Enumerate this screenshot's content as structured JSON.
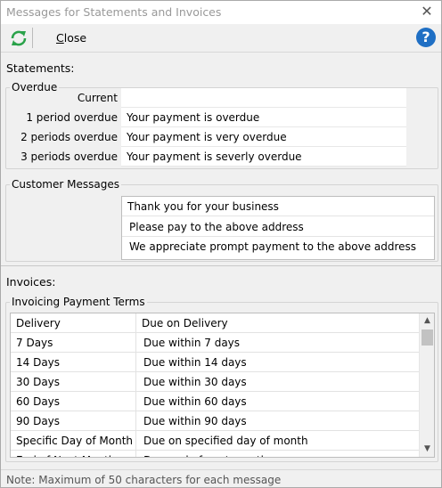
{
  "window": {
    "title": "Messages for Statements and Invoices"
  },
  "toolbar": {
    "close_label": "Close",
    "help_label": "?"
  },
  "statements": {
    "label": "Statements:",
    "overdue": {
      "title": "Overdue",
      "rows": [
        {
          "label": "Current",
          "value": ""
        },
        {
          "label": "1 period overdue",
          "value": "Your payment is overdue"
        },
        {
          "label": "2 periods overdue",
          "value": "Your payment is very overdue"
        },
        {
          "label": "3 periods overdue",
          "value": "Your payment is severly overdue"
        }
      ]
    },
    "customer_messages": {
      "title": "Customer Messages",
      "items": [
        "Thank you for your business",
        "Please pay to the above address",
        "We appreciate prompt payment to the above address"
      ]
    }
  },
  "invoices": {
    "label": "Invoices:",
    "payment_terms": {
      "title": "Invoicing Payment Terms",
      "rows": [
        {
          "term": "Delivery",
          "message": "Due on Delivery"
        },
        {
          "term": "7 Days",
          "message": "Due within 7 days"
        },
        {
          "term": "14 Days",
          "message": "Due within 14 days"
        },
        {
          "term": "30 Days",
          "message": "Due within 30 days"
        },
        {
          "term": "60 Days",
          "message": "Due within 60 days"
        },
        {
          "term": "90 Days",
          "message": "Due within 90 days"
        },
        {
          "term": "Specific Day of Month",
          "message": "Due on specified day of month"
        },
        {
          "term": "End of Next Month",
          "message": "Due end of next month"
        }
      ]
    }
  },
  "status": {
    "note": "Note: Maximum of  50 characters for each message"
  },
  "icons": {
    "refresh": "refresh-icon",
    "close": "close-icon",
    "help": "help-icon"
  },
  "colors": {
    "help_accent": "#1f6fc4",
    "refresh_accent": "#2aa24a"
  }
}
